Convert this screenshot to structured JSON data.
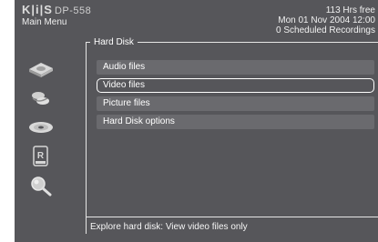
{
  "header": {
    "brand_logo": "K|i|S",
    "model": "DP-558",
    "menu_title": "Main Menu"
  },
  "info": {
    "free": "113 Hrs free",
    "datetime": "Mon 01 Nov 2004 12:00",
    "scheduled": "0 Scheduled Recordings"
  },
  "sidebar": {
    "icons": [
      "hard-disk-icon",
      "network-icon",
      "disc-icon",
      "rec-icon",
      "search-icon"
    ]
  },
  "panel": {
    "title": "Hard Disk",
    "items": [
      {
        "label": "Audio files"
      },
      {
        "label": "Video files"
      },
      {
        "label": "Picture files"
      },
      {
        "label": "Hard Disk options"
      }
    ],
    "selected_index": 1
  },
  "status": {
    "text": "Explore hard disk: View video files only"
  },
  "colors": {
    "background": "#56565a",
    "item": "#6a6a6e",
    "text": "#ffffff"
  }
}
